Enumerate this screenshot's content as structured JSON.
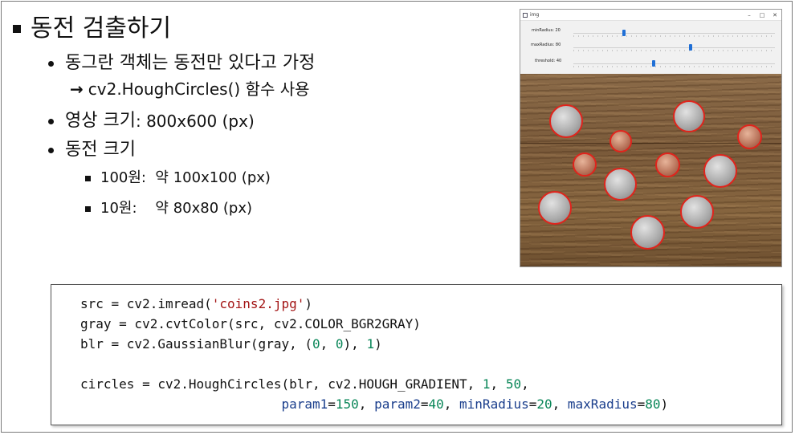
{
  "title": "동전 검출하기",
  "bullets": {
    "assumption": "동그란 객체는 동전만 있다고 가정",
    "arrow_text": "cv2.HoughCircles() 함수 사용",
    "image_size_label": "영상 크기",
    "image_size_value": ": 800x600 (px)",
    "coin_size_label": "동전 크기",
    "coin_100_label": "100원",
    "coin_100_value": ":  약 100x100 (px)",
    "coin_10_label": "10원",
    "coin_10_value": ":    약 80x80 (px)"
  },
  "window": {
    "title": "img",
    "controls": [
      "–",
      "□",
      "✕"
    ],
    "trackbars": [
      {
        "label": "minRadius: 20",
        "value_fraction": 0.25
      },
      {
        "label": "maxRadius: 80",
        "value_fraction": 0.58
      },
      {
        "label": "threshold: 40",
        "value_fraction": 0.4
      }
    ]
  },
  "code": {
    "l1": {
      "a": "src = cv2.imread(",
      "s": "'coins2.jpg'",
      "b": ")"
    },
    "l2": "gray = cv2.cvtColor(src, cv2.COLOR_BGR2GRAY)",
    "l3": {
      "a": "blr = cv2.GaussianBlur(gray, (",
      "n1": "0",
      "c": ", ",
      "n2": "0",
      "d": "), ",
      "n3": "1",
      "e": ")"
    },
    "l5": {
      "a": "circles = cv2.HoughCircles(blr, cv2.HOUGH_GRADIENT, ",
      "n1": "1",
      "c": ", ",
      "n2": "50",
      "d": ","
    },
    "l6": {
      "indent": "                          ",
      "k1": "param1",
      "v1": "150",
      "k2": "param2",
      "v2": "40",
      "k3": "minRadius",
      "v3": "20",
      "k4": "maxRadius",
      "v4": "80",
      "end": ")"
    }
  },
  "colors": {
    "circle": "#e0241c",
    "string": "#a31515",
    "number": "#098658",
    "keyword": "#1a3e8c"
  }
}
